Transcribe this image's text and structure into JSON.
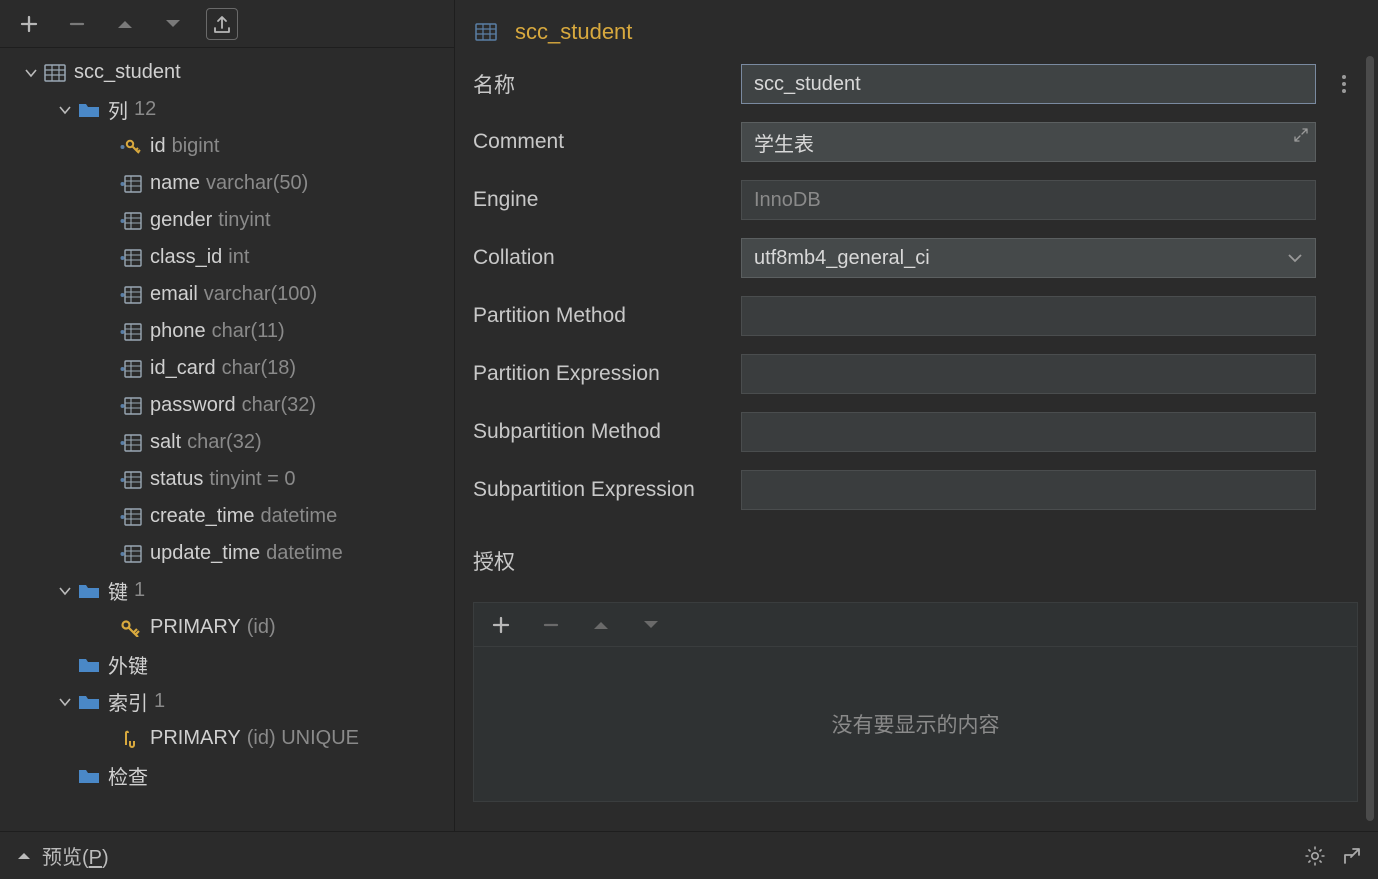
{
  "sidebar": {
    "table_name": "scc_student",
    "columns_label": "列",
    "columns_count": "12",
    "columns": [
      {
        "name": "id",
        "type": "bigint",
        "pk": true
      },
      {
        "name": "name",
        "type": "varchar(50)",
        "pk": false
      },
      {
        "name": "gender",
        "type": "tinyint",
        "pk": false
      },
      {
        "name": "class_id",
        "type": "int",
        "pk": false
      },
      {
        "name": "email",
        "type": "varchar(100)",
        "pk": false
      },
      {
        "name": "phone",
        "type": "char(11)",
        "pk": false
      },
      {
        "name": "id_card",
        "type": "char(18)",
        "pk": false
      },
      {
        "name": "password",
        "type": "char(32)",
        "pk": false
      },
      {
        "name": "salt",
        "type": "char(32)",
        "pk": false
      },
      {
        "name": "status",
        "type": "tinyint = 0",
        "pk": false
      },
      {
        "name": "create_time",
        "type": "datetime",
        "pk": false
      },
      {
        "name": "update_time",
        "type": "datetime",
        "pk": false
      }
    ],
    "keys_label": "键",
    "keys_count": "1",
    "keys": [
      {
        "name": "PRIMARY",
        "detail": "(id)"
      }
    ],
    "foreign_keys_label": "外键",
    "indexes_label": "索引",
    "indexes_count": "1",
    "indexes": [
      {
        "name": "PRIMARY",
        "detail": "(id) UNIQUE"
      }
    ],
    "checks_label": "检查"
  },
  "detail": {
    "title": "scc_student",
    "fields": {
      "name_label": "名称",
      "name_value": "scc_student",
      "comment_label": "Comment",
      "comment_value": "学生表",
      "engine_label": "Engine",
      "engine_value": "InnoDB",
      "collation_label": "Collation",
      "collation_value": "utf8mb4_general_ci",
      "partition_method_label": "Partition Method",
      "partition_method_value": "",
      "partition_expression_label": "Partition Expression",
      "partition_expression_value": "",
      "subpartition_method_label": "Subpartition Method",
      "subpartition_method_value": "",
      "subpartition_expression_label": "Subpartition Expression",
      "subpartition_expression_value": ""
    },
    "grants_label": "授权",
    "grants_empty": "没有要显示的内容"
  },
  "footer": {
    "preview_label_prefix": "预览(",
    "preview_label_hotkey": "P",
    "preview_label_suffix": ")"
  }
}
